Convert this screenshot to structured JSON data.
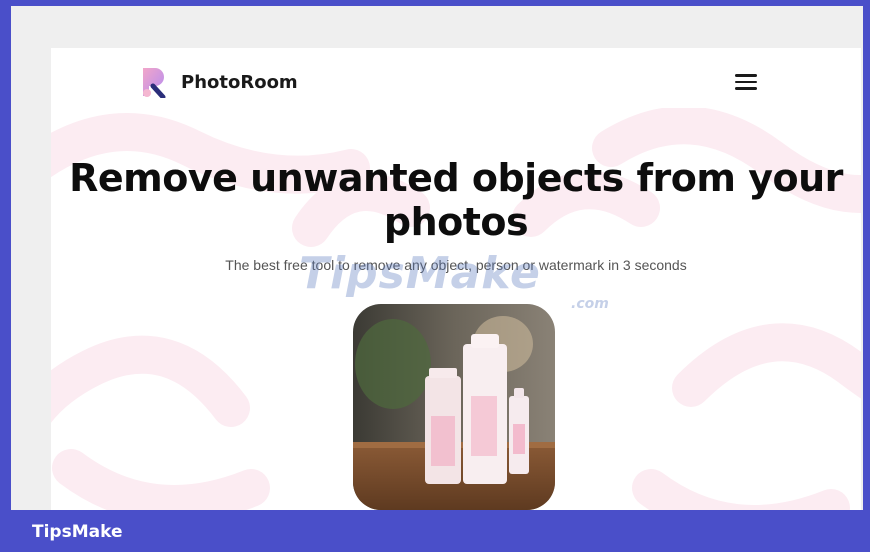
{
  "app": {
    "brand_name": "PhotoRoom",
    "logo_icon": "photoroom-logo-icon",
    "menu_icon": "hamburger-menu-icon"
  },
  "hero": {
    "title_line1": "Remove unwanted objects from your",
    "title_line2": "photos",
    "subtitle": "The best free tool to remove any object, person or watermark in 3 seconds"
  },
  "overlay": {
    "watermark_text": "TipsMake",
    "watermark_suffix": ".com"
  },
  "footer": {
    "brand": "TipsMake"
  },
  "colors": {
    "frame_accent": "#4a4fc9",
    "title_text": "#0d0d0d",
    "pattern_pink": "#fbe6ee"
  }
}
